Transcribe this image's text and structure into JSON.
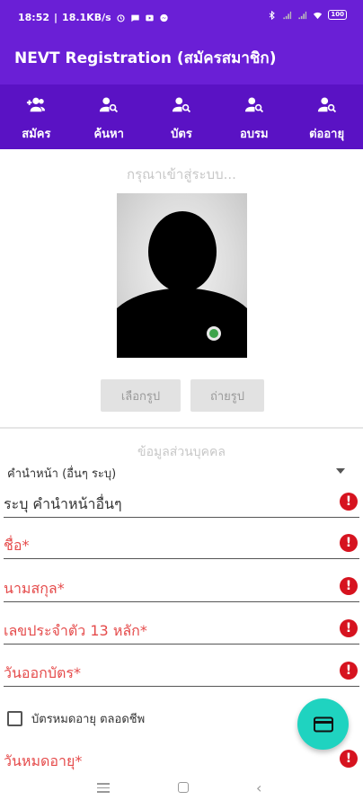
{
  "status_bar": {
    "time": "18:52",
    "network_speed": "18.1KB/s",
    "battery": "100",
    "icons": [
      "alarm-icon",
      "chat-icon",
      "video-icon",
      "messenger-icon",
      "bluetooth-icon",
      "signal-icon",
      "signal-icon",
      "wifi-icon",
      "battery-icon"
    ]
  },
  "app_bar": {
    "title": "NEVT Registration (สมัครสมาชิก)"
  },
  "tabs": [
    {
      "label": "สมัคร",
      "icon": "add-person-icon"
    },
    {
      "label": "ค้นหา",
      "icon": "person-search-icon"
    },
    {
      "label": "บัตร",
      "icon": "person-search-icon"
    },
    {
      "label": "อบรม",
      "icon": "person-search-icon"
    },
    {
      "label": "ต่ออายุ",
      "icon": "person-search-icon"
    }
  ],
  "login_hint": "กรุณาเข้าสู่ระบบ...",
  "photo": {
    "icon": "avatar-placeholder-icon"
  },
  "buttons": {
    "choose_photo": "เลือกรูป",
    "take_photo": "ถ่ายรูป"
  },
  "section_title": "ข้อมูลส่วนบุคคล",
  "prefix_select": {
    "value": "คำนำหน้า (อื่นๆ ระบุ)"
  },
  "fields": [
    {
      "placeholder": "ระบุ คำนำหน้าอื่นๆ",
      "required": false
    },
    {
      "placeholder": "ชื่อ*",
      "required": true
    },
    {
      "placeholder": "นามสกุล*",
      "required": true
    },
    {
      "placeholder": "เลขประจำตัว 13 หลัก*",
      "required": true
    },
    {
      "placeholder": "วันออกบัตร*",
      "required": true
    },
    {
      "placeholder": "วันหมดอายุ*",
      "required": true
    }
  ],
  "lifetime_checkbox": {
    "label": "บัตรหมดอายุ ตลอดชีพ",
    "checked": false
  },
  "fab": {
    "icon": "card-icon",
    "color": "#1fd3c0"
  },
  "colors": {
    "primary": "#6a1fd6",
    "tab_bar": "#5a12c4",
    "error": "#d6131f",
    "required_text": "#e54b4b"
  },
  "nav_bar": {
    "icons": [
      "menu-icon",
      "home-icon",
      "back-icon"
    ],
    "back_glyph": "‹"
  }
}
